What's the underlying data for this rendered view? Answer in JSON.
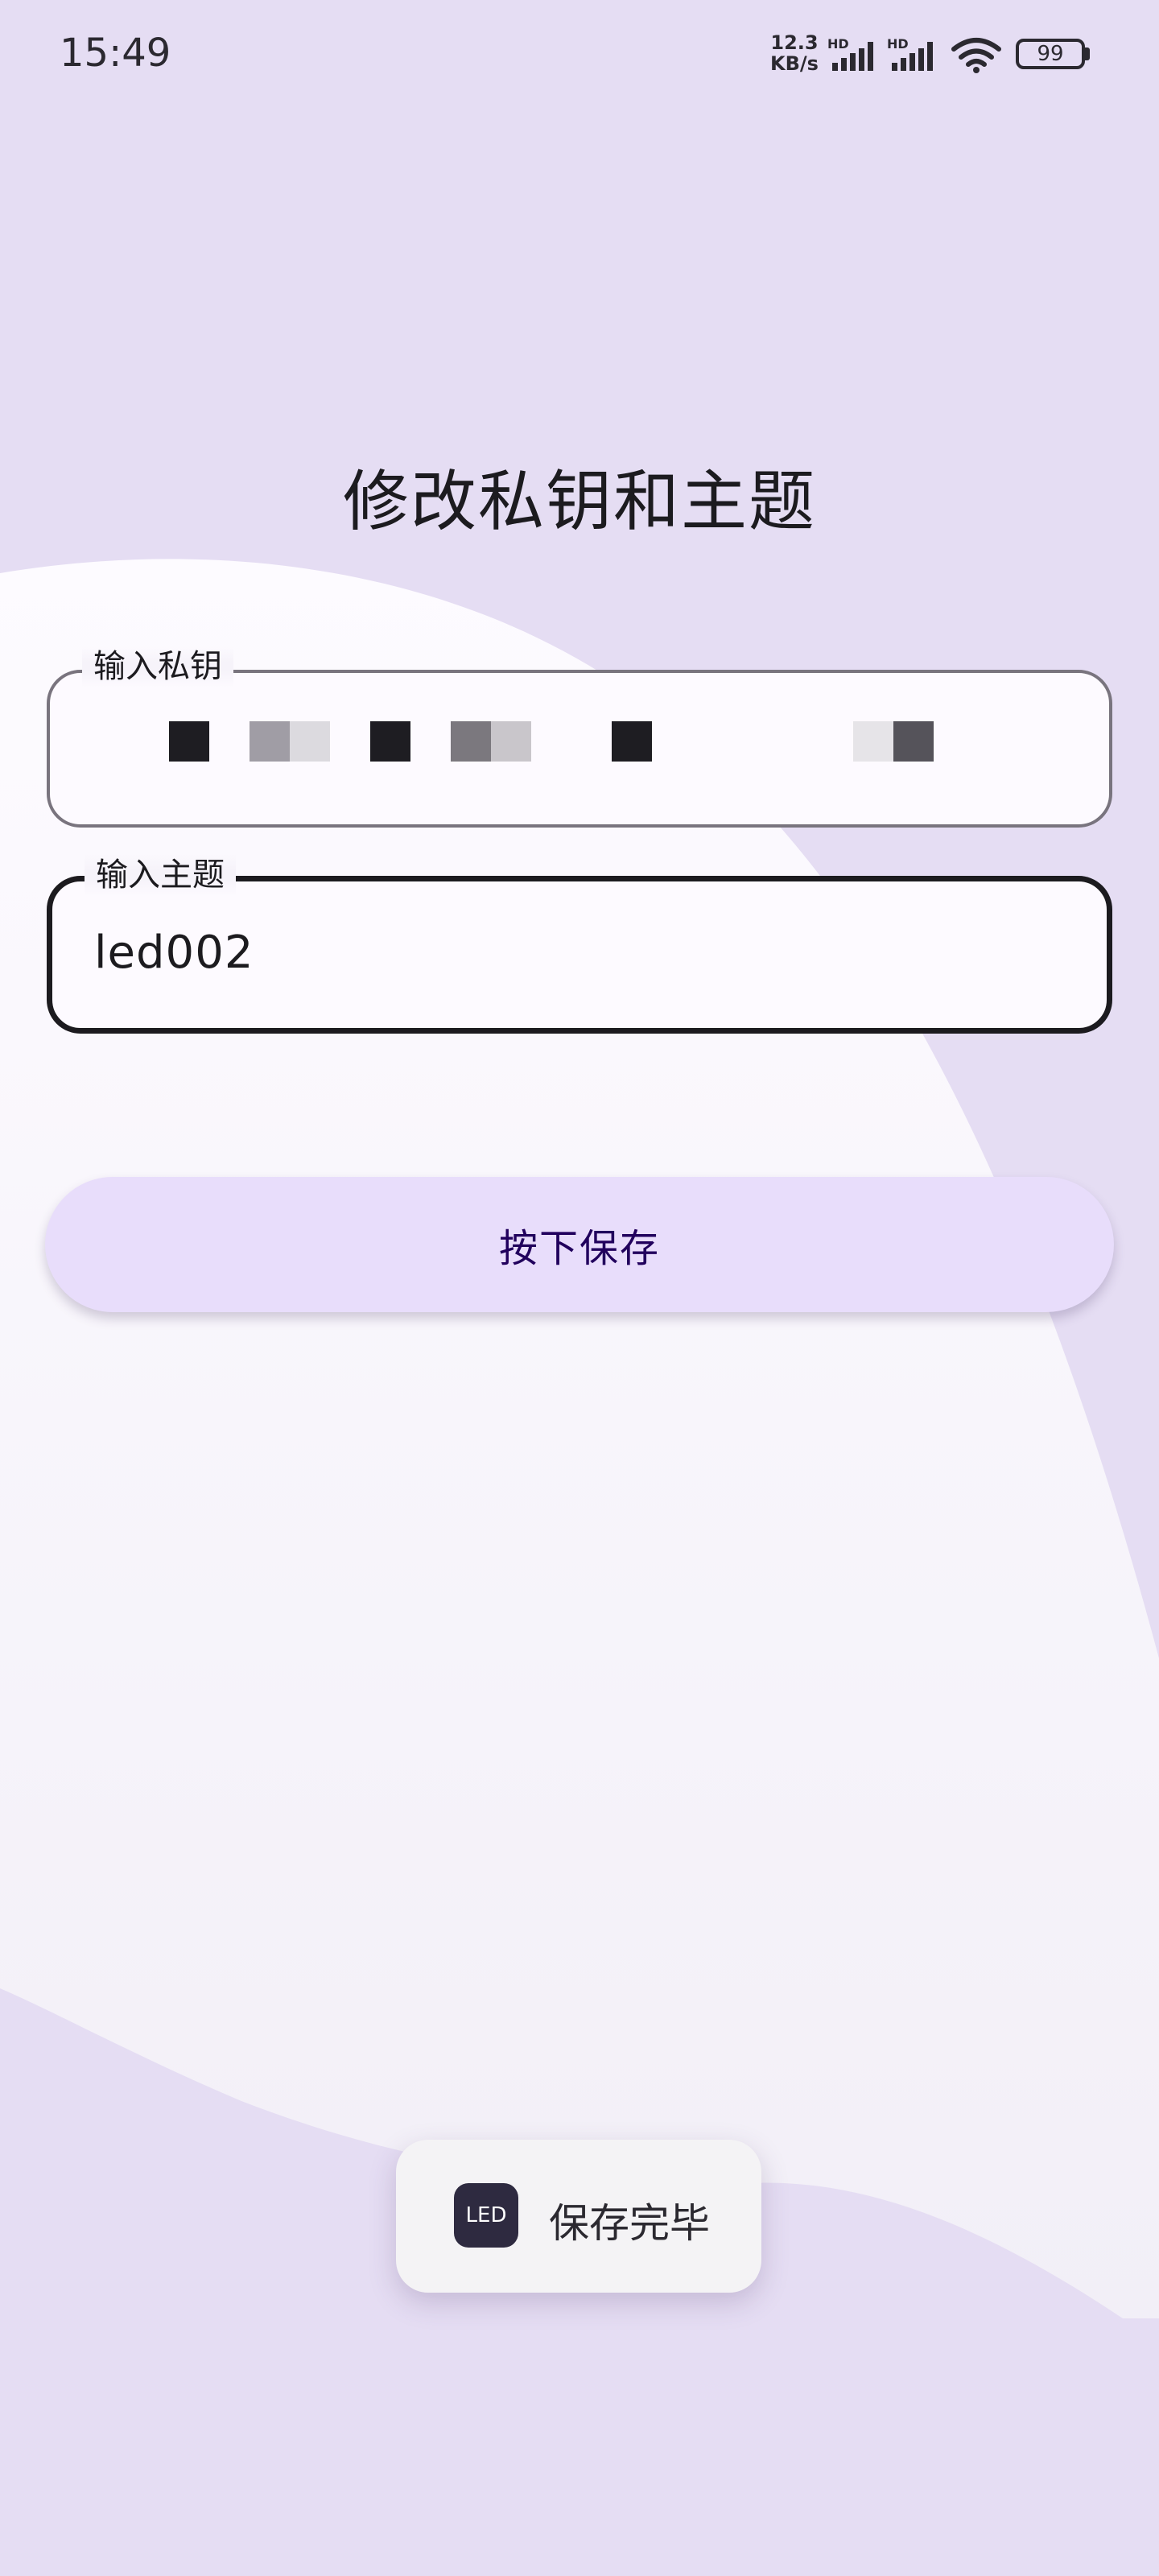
{
  "status_bar": {
    "time": "15:49",
    "net_speed_value": "12.3",
    "net_speed_unit": "KB/s",
    "signal_1_badge": "HD",
    "signal_2_badge": "HD",
    "battery_level": "99",
    "icons": [
      "signal-icon",
      "signal-icon",
      "wifi-icon",
      "battery-icon"
    ]
  },
  "page": {
    "title": "修改私钥和主题"
  },
  "form": {
    "key_field": {
      "label": "输入私钥",
      "value_state": "pixelated-redacted"
    },
    "topic_field": {
      "label": "输入主题",
      "value": "led002"
    },
    "save_button_label": "按下保存"
  },
  "toast": {
    "icon_text": "LED",
    "message": "保存完毕"
  },
  "colors": {
    "background": "#e5ddf3",
    "surface": "#fdfaff",
    "button": "#e8ddfb",
    "button_text": "#21005d",
    "outline": "#79747e",
    "focused_outline": "#1c1b1f",
    "toast_icon": "#2e2a40"
  }
}
